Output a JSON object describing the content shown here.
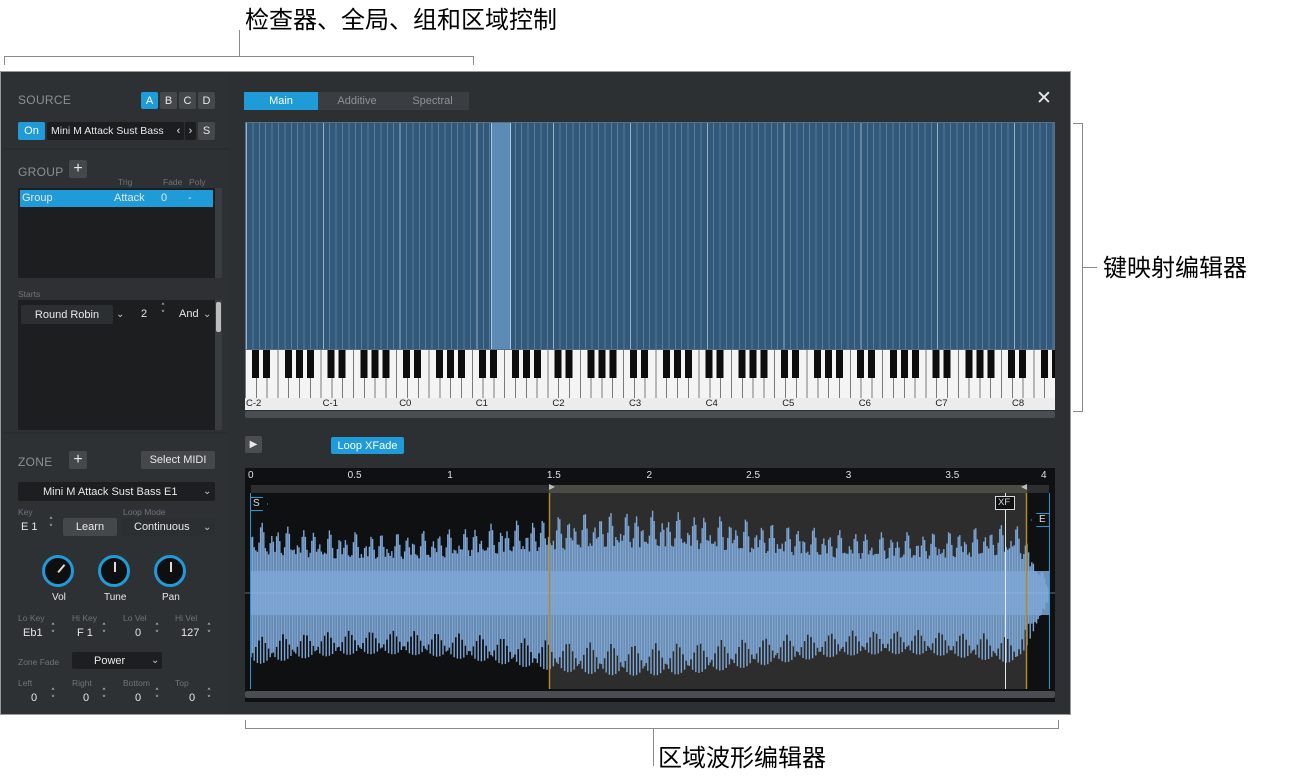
{
  "callouts": {
    "top": "检查器、全局、组和区域控制",
    "right": "键映射编辑器",
    "bottom": "区域波形编辑器"
  },
  "inspector": {
    "source": {
      "title": "SOURCE",
      "buttons": [
        "A",
        "B",
        "C",
        "D"
      ],
      "on_label": "On",
      "instrument": "Mini M Attack Sust Bass",
      "prev": "‹",
      "next": "›",
      "s_label": "S"
    },
    "group": {
      "title": "GROUP",
      "add": "+",
      "columns": {
        "trig": "Trig",
        "fade": "Fade",
        "poly": "Poly"
      },
      "row": {
        "name": "Group",
        "trig": "Attack",
        "fade": "0",
        "poly": "-"
      },
      "starts_label": "Starts",
      "round_robin": "Round Robin",
      "rr_value": "2",
      "and_label": "And"
    },
    "zone": {
      "title": "ZONE",
      "add": "+",
      "select_midi": "Select MIDI",
      "zone_name": "Mini M Attack Sust Bass E1",
      "key_label": "Key",
      "key_value": "E 1",
      "learn": "Learn",
      "loop_mode_label": "Loop Mode",
      "loop_mode": "Continuous",
      "knobs": [
        "Vol",
        "Tune",
        "Pan"
      ],
      "lo_key_label": "Lo Key",
      "lo_key": "Eb1",
      "hi_key_label": "Hi Key",
      "hi_key": "F 1",
      "lo_vel_label": "Lo Vel",
      "lo_vel": "0",
      "hi_vel_label": "Hi Vel",
      "hi_vel": "127",
      "zone_fade_label": "Zone Fade",
      "zone_fade": "Power",
      "left_label": "Left",
      "left": "0",
      "right_label": "Right",
      "right": "0",
      "bottom_label": "Bottom",
      "bottom": "0",
      "top_label": "Top",
      "top": "0"
    }
  },
  "editor": {
    "tabs": [
      "Main",
      "Additive",
      "Spectral"
    ],
    "active_tab": "Main",
    "close": "✕",
    "octave_labels": [
      "C-2",
      "C-1",
      "C0",
      "C1",
      "C2",
      "C3",
      "C4",
      "C5",
      "C6",
      "C7",
      "C8"
    ],
    "play": "▶",
    "loop_xfade": "Loop XFade",
    "time_labels": [
      "0",
      "0.5",
      "1",
      "1.5",
      "2",
      "2.5",
      "3",
      "3.5",
      "4"
    ],
    "marker_s": "S",
    "marker_e": "E",
    "marker_xf": "XF"
  },
  "colors": {
    "accent": "#1f9bd7",
    "keymap_bg": "#32597a",
    "wave": "#7ea6d6",
    "loop_marker": "#b08a28"
  }
}
